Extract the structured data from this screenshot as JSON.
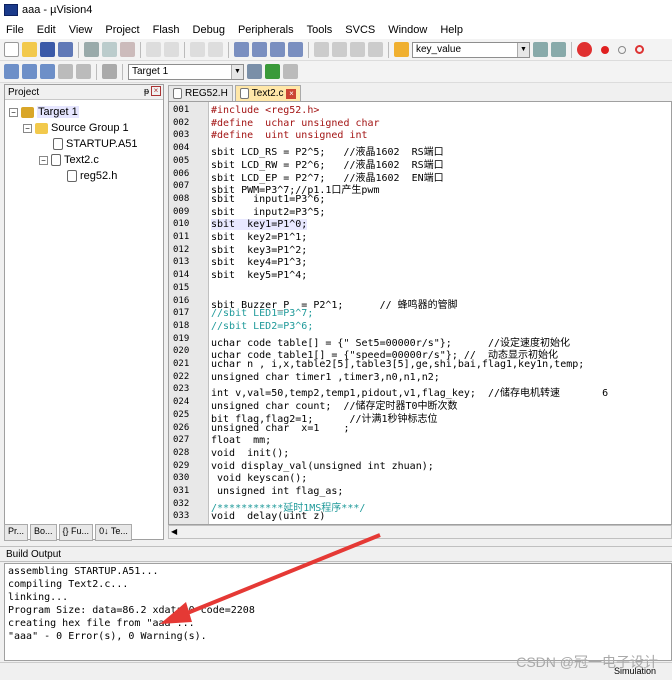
{
  "window": {
    "title": "aaa - µVision4"
  },
  "menu": [
    "File",
    "Edit",
    "View",
    "Project",
    "Flash",
    "Debug",
    "Peripherals",
    "Tools",
    "SVCS",
    "Window",
    "Help"
  ],
  "toolbar": {
    "find_combo": "key_value",
    "target_combo": "Target 1"
  },
  "project": {
    "header": "Project",
    "pin": "ᵽ",
    "tree": {
      "target": "Target 1",
      "group": "Source Group 1",
      "file1": "STARTUP.A51",
      "file2": "Text2.c",
      "file3": "reg52.h"
    },
    "tabs": [
      "Pr...",
      "Bo...",
      "{} Fu...",
      "0↓ Te..."
    ]
  },
  "editor": {
    "tabs": [
      "REG52.H",
      "Text2.c"
    ],
    "line_numbers": [
      "001",
      "002",
      "003",
      "004",
      "005",
      "006",
      "007",
      "008",
      "009",
      "010",
      "011",
      "012",
      "013",
      "014",
      "015",
      "016",
      "017",
      "018",
      "019",
      "020",
      "021",
      "022",
      "023",
      "024",
      "025",
      "026",
      "027",
      "028",
      "029",
      "030",
      "031",
      "032",
      "033"
    ],
    "lines": [
      "#include <reg52.h>",
      "#define  uchar unsigned char",
      "#define  uint unsigned int",
      "sbit LCD_RS = P2^5;   //液晶1602  RS端口",
      "sbit LCD_RW = P2^6;   //液晶1602  RS端口",
      "sbit LCD_EP = P2^7;   //液晶1602  EN端口",
      "sbit PWM=P3^7;//p1.1口产生pwm",
      "sbit   input1=P3^6;",
      "sbit   input2=P3^5;",
      "sbit  key1=P1^0;",
      "sbit  key2=P1^1;",
      "sbit  key3=P1^2;",
      "sbit  key4=P1^3;",
      "sbit  key5=P1^4;",
      "",
      "sbit Buzzer_P  = P2^1;      // 蜂鸣器的管脚",
      "//sbit LED1=P3^7;",
      "//sbit LED2=P3^6;",
      "uchar code table[] = {\" Set5=00000r/s\"};      //设定速度初始化",
      "uchar code table1[] = {\"speed=00000r/s\"}; //  动态显示初始化",
      "uchar n , i,x,table2[5],table3[5],ge,shi,bai,flag1,key1n,temp;",
      "unsigned char timer1 ,timer3,n0,n1,n2;",
      "int v,val=50,temp2,temp1,pidout,v1,flag_key;  //储存电机转速       6",
      "unsigned char count;  //储存定时器T0中断次数",
      "bit flag,flag2=1;      //计满1秒钟标志位",
      "unsigned char  x=1    ;",
      "float  mm;",
      "void  init();",
      "void display_val(unsigned int zhuan);",
      " void keyscan();",
      " unsigned int flag_as;",
      "/***********延时1MS程序***/",
      "void  delay(uint z)"
    ]
  },
  "build": {
    "header": "Build Output",
    "lines": [
      "assembling STARTUP.A51...",
      "compiling Text2.c...",
      "linking...",
      "Program Size: data=86.2 xdata=0 code=2208",
      "creating hex file from \"aaa\"...",
      "\"aaa\" - 0 Error(s), 0 Warning(s)."
    ]
  },
  "status": {
    "mode": "Simulation"
  },
  "watermark": "CSDN @冠一电子设计",
  "colors": {
    "comment": "#1f9a9a",
    "keyword": "#1a1aa6",
    "arrow": "#e53935",
    "active_tab": "#ffe7a8"
  }
}
